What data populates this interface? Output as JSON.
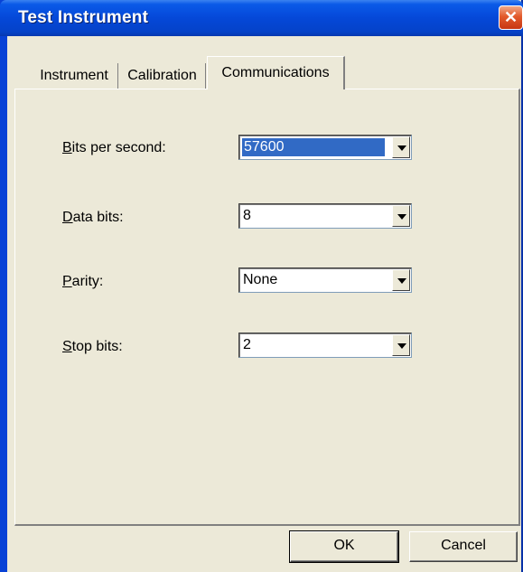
{
  "window": {
    "title": "Test Instrument",
    "close_symbol": "✕"
  },
  "tabs": [
    {
      "label": "Instrument"
    },
    {
      "label": "Calibration"
    },
    {
      "label": "Communications",
      "active": true
    }
  ],
  "fields": [
    {
      "label_first": "B",
      "label_rest": "its per second:",
      "value": "57600"
    },
    {
      "label_first": "D",
      "label_rest": "ata bits:",
      "value": "8"
    },
    {
      "label_first": "P",
      "label_rest": "arity:",
      "value": "None"
    },
    {
      "label_first": "S",
      "label_rest": "top bits:",
      "value": "2"
    }
  ],
  "buttons": {
    "ok": "OK",
    "cancel": "Cancel"
  },
  "colors": {
    "title_bar": "#0548d8",
    "dialog_face": "#ece9d8",
    "selection": "#316ac5",
    "close_button": "#e35a2b"
  }
}
